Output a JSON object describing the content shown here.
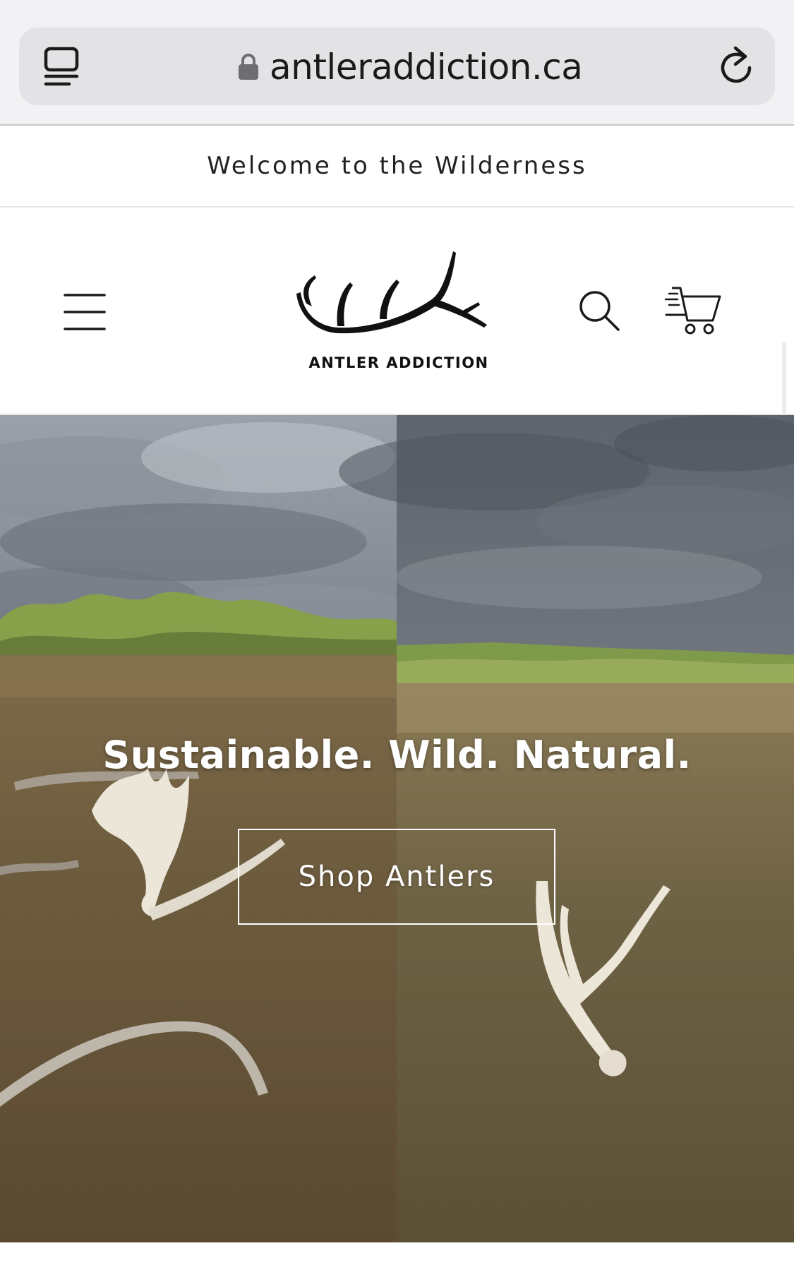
{
  "browser": {
    "url": "antleraddiction.ca",
    "icons": [
      "tabs-icon",
      "lock-icon",
      "reload-icon"
    ]
  },
  "announcement": {
    "text": "Welcome to the Wilderness"
  },
  "header": {
    "logo_text": "ANTLER ADDICTION",
    "icons": [
      "menu-icon",
      "antler-logo",
      "search-icon",
      "cart-icon"
    ]
  },
  "hero": {
    "heading": "Sustainable. Wild. Natural.",
    "button_label": "Shop Antlers"
  },
  "colors": {
    "background": "#ffffff",
    "chrome": "#f2f2f4",
    "url_field": "#e3e3e6",
    "text": "#1a1a1a",
    "hero_text": "#ffffff"
  }
}
